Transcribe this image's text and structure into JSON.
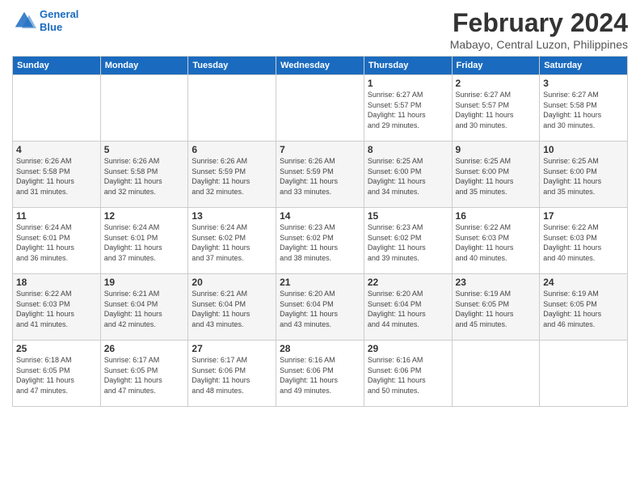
{
  "logo": {
    "line1": "General",
    "line2": "Blue"
  },
  "title": "February 2024",
  "subtitle": "Mabayo, Central Luzon, Philippines",
  "days_of_week": [
    "Sunday",
    "Monday",
    "Tuesday",
    "Wednesday",
    "Thursday",
    "Friday",
    "Saturday"
  ],
  "weeks": [
    [
      {
        "day": "",
        "detail": ""
      },
      {
        "day": "",
        "detail": ""
      },
      {
        "day": "",
        "detail": ""
      },
      {
        "day": "",
        "detail": ""
      },
      {
        "day": "1",
        "detail": "Sunrise: 6:27 AM\nSunset: 5:57 PM\nDaylight: 11 hours\nand 29 minutes."
      },
      {
        "day": "2",
        "detail": "Sunrise: 6:27 AM\nSunset: 5:57 PM\nDaylight: 11 hours\nand 30 minutes."
      },
      {
        "day": "3",
        "detail": "Sunrise: 6:27 AM\nSunset: 5:58 PM\nDaylight: 11 hours\nand 30 minutes."
      }
    ],
    [
      {
        "day": "4",
        "detail": "Sunrise: 6:26 AM\nSunset: 5:58 PM\nDaylight: 11 hours\nand 31 minutes."
      },
      {
        "day": "5",
        "detail": "Sunrise: 6:26 AM\nSunset: 5:58 PM\nDaylight: 11 hours\nand 32 minutes."
      },
      {
        "day": "6",
        "detail": "Sunrise: 6:26 AM\nSunset: 5:59 PM\nDaylight: 11 hours\nand 32 minutes."
      },
      {
        "day": "7",
        "detail": "Sunrise: 6:26 AM\nSunset: 5:59 PM\nDaylight: 11 hours\nand 33 minutes."
      },
      {
        "day": "8",
        "detail": "Sunrise: 6:25 AM\nSunset: 6:00 PM\nDaylight: 11 hours\nand 34 minutes."
      },
      {
        "day": "9",
        "detail": "Sunrise: 6:25 AM\nSunset: 6:00 PM\nDaylight: 11 hours\nand 35 minutes."
      },
      {
        "day": "10",
        "detail": "Sunrise: 6:25 AM\nSunset: 6:00 PM\nDaylight: 11 hours\nand 35 minutes."
      }
    ],
    [
      {
        "day": "11",
        "detail": "Sunrise: 6:24 AM\nSunset: 6:01 PM\nDaylight: 11 hours\nand 36 minutes."
      },
      {
        "day": "12",
        "detail": "Sunrise: 6:24 AM\nSunset: 6:01 PM\nDaylight: 11 hours\nand 37 minutes."
      },
      {
        "day": "13",
        "detail": "Sunrise: 6:24 AM\nSunset: 6:02 PM\nDaylight: 11 hours\nand 37 minutes."
      },
      {
        "day": "14",
        "detail": "Sunrise: 6:23 AM\nSunset: 6:02 PM\nDaylight: 11 hours\nand 38 minutes."
      },
      {
        "day": "15",
        "detail": "Sunrise: 6:23 AM\nSunset: 6:02 PM\nDaylight: 11 hours\nand 39 minutes."
      },
      {
        "day": "16",
        "detail": "Sunrise: 6:22 AM\nSunset: 6:03 PM\nDaylight: 11 hours\nand 40 minutes."
      },
      {
        "day": "17",
        "detail": "Sunrise: 6:22 AM\nSunset: 6:03 PM\nDaylight: 11 hours\nand 40 minutes."
      }
    ],
    [
      {
        "day": "18",
        "detail": "Sunrise: 6:22 AM\nSunset: 6:03 PM\nDaylight: 11 hours\nand 41 minutes."
      },
      {
        "day": "19",
        "detail": "Sunrise: 6:21 AM\nSunset: 6:04 PM\nDaylight: 11 hours\nand 42 minutes."
      },
      {
        "day": "20",
        "detail": "Sunrise: 6:21 AM\nSunset: 6:04 PM\nDaylight: 11 hours\nand 43 minutes."
      },
      {
        "day": "21",
        "detail": "Sunrise: 6:20 AM\nSunset: 6:04 PM\nDaylight: 11 hours\nand 43 minutes."
      },
      {
        "day": "22",
        "detail": "Sunrise: 6:20 AM\nSunset: 6:04 PM\nDaylight: 11 hours\nand 44 minutes."
      },
      {
        "day": "23",
        "detail": "Sunrise: 6:19 AM\nSunset: 6:05 PM\nDaylight: 11 hours\nand 45 minutes."
      },
      {
        "day": "24",
        "detail": "Sunrise: 6:19 AM\nSunset: 6:05 PM\nDaylight: 11 hours\nand 46 minutes."
      }
    ],
    [
      {
        "day": "25",
        "detail": "Sunrise: 6:18 AM\nSunset: 6:05 PM\nDaylight: 11 hours\nand 47 minutes."
      },
      {
        "day": "26",
        "detail": "Sunrise: 6:17 AM\nSunset: 6:05 PM\nDaylight: 11 hours\nand 47 minutes."
      },
      {
        "day": "27",
        "detail": "Sunrise: 6:17 AM\nSunset: 6:06 PM\nDaylight: 11 hours\nand 48 minutes."
      },
      {
        "day": "28",
        "detail": "Sunrise: 6:16 AM\nSunset: 6:06 PM\nDaylight: 11 hours\nand 49 minutes."
      },
      {
        "day": "29",
        "detail": "Sunrise: 6:16 AM\nSunset: 6:06 PM\nDaylight: 11 hours\nand 50 minutes."
      },
      {
        "day": "",
        "detail": ""
      },
      {
        "day": "",
        "detail": ""
      }
    ]
  ]
}
